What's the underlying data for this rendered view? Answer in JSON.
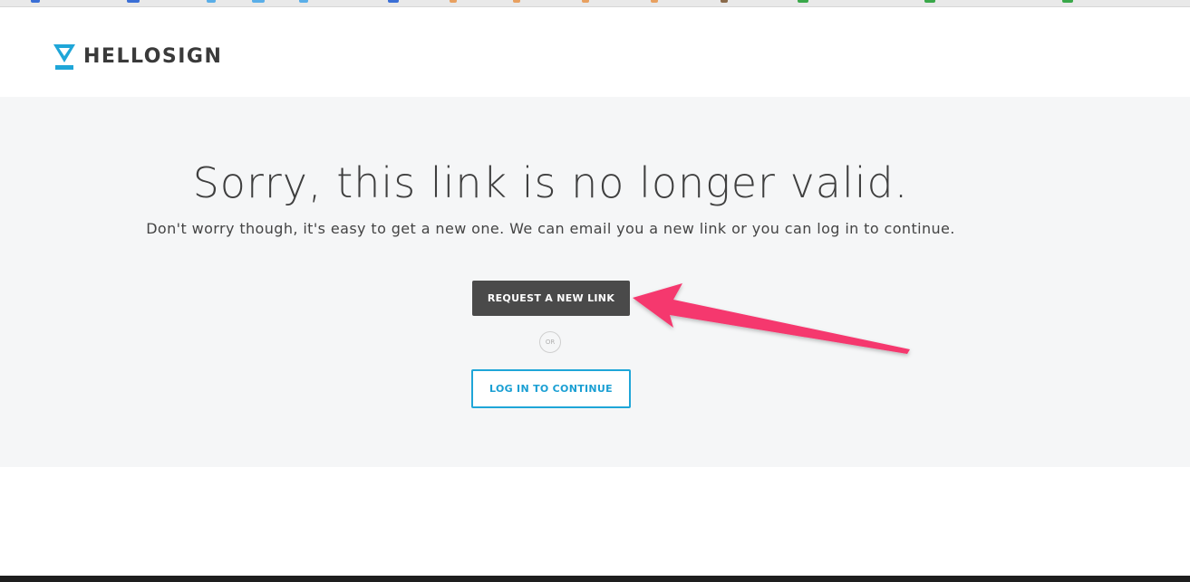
{
  "brand": {
    "name": "HELLOSIGN",
    "colors": {
      "accent": "#1fa6d8",
      "dark": "#4a4a4a",
      "annotation": "#f5376e"
    }
  },
  "message": {
    "headline": "Sorry, this link is no longer valid.",
    "subtext": "Don't worry though, it's easy to get a new one. We can email you a new link or you can log in to continue."
  },
  "actions": {
    "request_label": "REQUEST A NEW LINK",
    "divider_label": "OR",
    "login_label": "LOG IN TO CONTINUE"
  },
  "annotation": {
    "icon": "arrow-icon",
    "target": "request-new-link-button"
  }
}
